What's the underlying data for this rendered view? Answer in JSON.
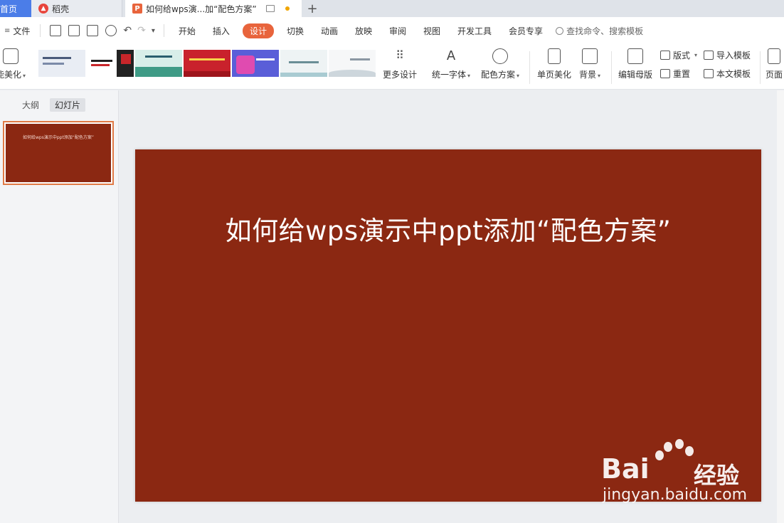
{
  "tabs": {
    "home": "首页",
    "daoke": "稻壳",
    "doc": "如何给wps演...加“配色方案”"
  },
  "menu": {
    "file": "文件",
    "tabs": [
      "开始",
      "插入",
      "设计",
      "切换",
      "动画",
      "放映",
      "审阅",
      "视图",
      "开发工具",
      "会员专享"
    ],
    "active_tab": "设计",
    "search_placeholder": "查找命令、搜索模板"
  },
  "ribbon": {
    "smart_beautify": "能美化",
    "more_design": "更多设计",
    "unify_font": "统一字体",
    "color_scheme": "配色方案",
    "page_beautify": "单页美化",
    "background": "背景",
    "edit_master": "编辑母版",
    "layout": "版式",
    "reset": "重置",
    "import_template": "导入模板",
    "this_template": "本文模板",
    "page": "页面",
    "template_thumbs": [
      "dark-grey",
      "black-red",
      "teal-green",
      "red",
      "blue-purple",
      "light-blue",
      "white-grey"
    ]
  },
  "leftpanel": {
    "outline_tab": "大纲",
    "slides_tab": "幻灯片",
    "thumb_title": "如何给wps演示中ppt添加“配色方案”"
  },
  "slide": {
    "title": "如何给wps演示中ppt添加“配色方案”",
    "bg_color": "#8b2812"
  },
  "watermark": {
    "brand": "Bai",
    "brand_cn": "经验",
    "url": "jingyan.baidu.com"
  },
  "colors": {
    "accent": "#e8643c",
    "home_tab": "#4b7de8",
    "slide_bg": "#8b2812"
  }
}
